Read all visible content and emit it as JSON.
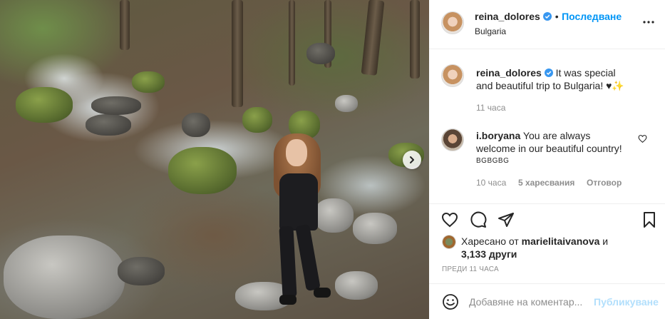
{
  "post": {
    "author": "reina_dolores",
    "location": "Bulgaria",
    "follow_label": "Последване",
    "separator": "•"
  },
  "caption": {
    "username": "reina_dolores",
    "text": "It was special and beautiful trip to Bulgaria! ♥✨",
    "time": "11 часа"
  },
  "comment": {
    "username": "i.boryana",
    "text": "You are always welcome in our beautiful country!",
    "flags": "BGBGBG",
    "time": "10 часа",
    "likes": "5 харесвания",
    "reply_label": "Отговор"
  },
  "likes": {
    "prefix": "Харесано от",
    "user": "marielitaivanova",
    "and": "и",
    "others": "3,133 други"
  },
  "posted_ago": "ПРЕДИ 11 ЧАСА",
  "composer": {
    "placeholder": "Добавяне на коментар...",
    "publish_label": "Публикуване"
  },
  "icons": {
    "verified": "verified-badge-icon",
    "more": "more-options-icon",
    "like": "heart-icon",
    "comment": "comment-bubble-icon",
    "share": "paper-plane-icon",
    "save": "bookmark-icon",
    "emoji": "smiley-icon",
    "next": "chevron-right-icon"
  },
  "colors": {
    "link_blue": "#0095f6",
    "publish_disabled": "#b2dffc",
    "secondary_text": "#8e8e8e",
    "verified_blue": "#3897f0"
  }
}
